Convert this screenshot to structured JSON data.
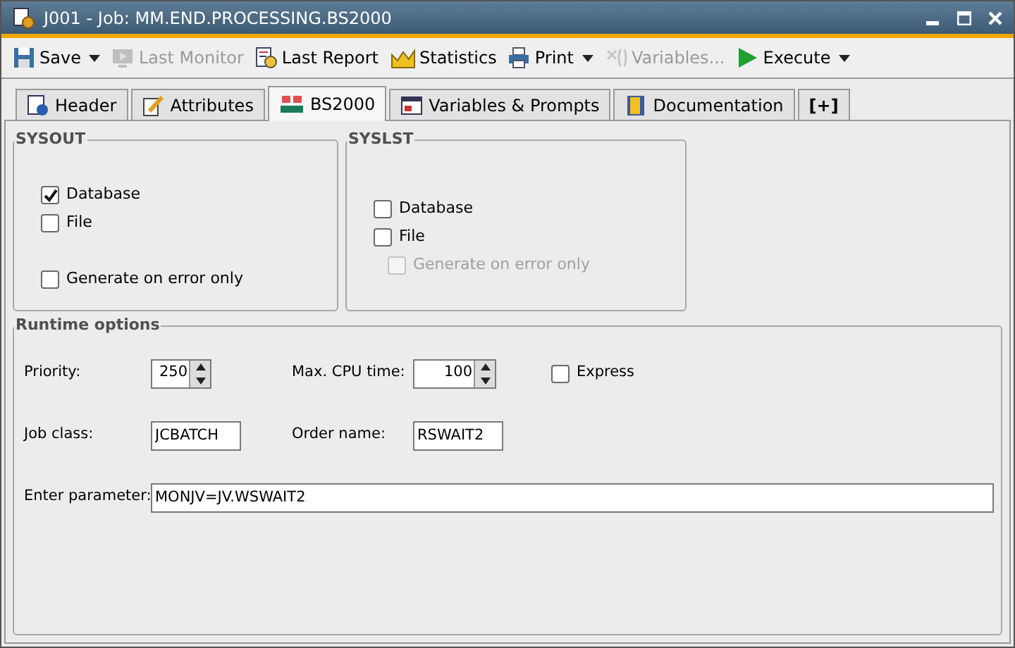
{
  "window": {
    "title": "J001 - Job: MM.END.PROCESSING.BS2000"
  },
  "toolbar": [
    {
      "label": "Save",
      "disabled": false,
      "dropdown": true
    },
    {
      "label": "Last Monitor",
      "disabled": true,
      "dropdown": false
    },
    {
      "label": "Last Report",
      "disabled": false,
      "dropdown": false
    },
    {
      "label": "Statistics",
      "disabled": false,
      "dropdown": false
    },
    {
      "label": "Print",
      "disabled": false,
      "dropdown": true
    },
    {
      "label": "Variables...",
      "disabled": true,
      "dropdown": false
    },
    {
      "label": "Execute",
      "disabled": false,
      "dropdown": true
    }
  ],
  "tabs": [
    {
      "label": "Header",
      "selected": false
    },
    {
      "label": "Attributes",
      "selected": false
    },
    {
      "label": "BS2000",
      "selected": true
    },
    {
      "label": "Variables & Prompts",
      "selected": false
    },
    {
      "label": "Documentation",
      "selected": false
    },
    {
      "label": "[+]",
      "selected": false
    }
  ],
  "sysout": {
    "title": "SYSOUT",
    "options": [
      {
        "label": "Database",
        "checked": true,
        "disabled": false
      },
      {
        "label": "File",
        "checked": false,
        "disabled": false
      },
      {
        "label": "Generate on error only",
        "checked": false,
        "disabled": false
      }
    ]
  },
  "syslst": {
    "title": "SYSLST",
    "options": [
      {
        "label": "Database",
        "checked": false,
        "disabled": false
      },
      {
        "label": "File",
        "checked": false,
        "disabled": false
      },
      {
        "label": "Generate on error only",
        "checked": false,
        "disabled": true
      }
    ]
  },
  "runtime": {
    "title": "Runtime options",
    "priority": {
      "label": "Priority:",
      "value": "250"
    },
    "max_cpu": {
      "label": "Max. CPU time:",
      "value": "100"
    },
    "express": {
      "label": "Express",
      "checked": false
    },
    "job_class": {
      "label": "Job class:",
      "value": "JCBATCH"
    },
    "order_name": {
      "label": "Order name:",
      "value": "RSWAIT2"
    },
    "parameter": {
      "label": "Enter parameter:",
      "value": "MONJV=JV.WSWAIT2"
    }
  }
}
